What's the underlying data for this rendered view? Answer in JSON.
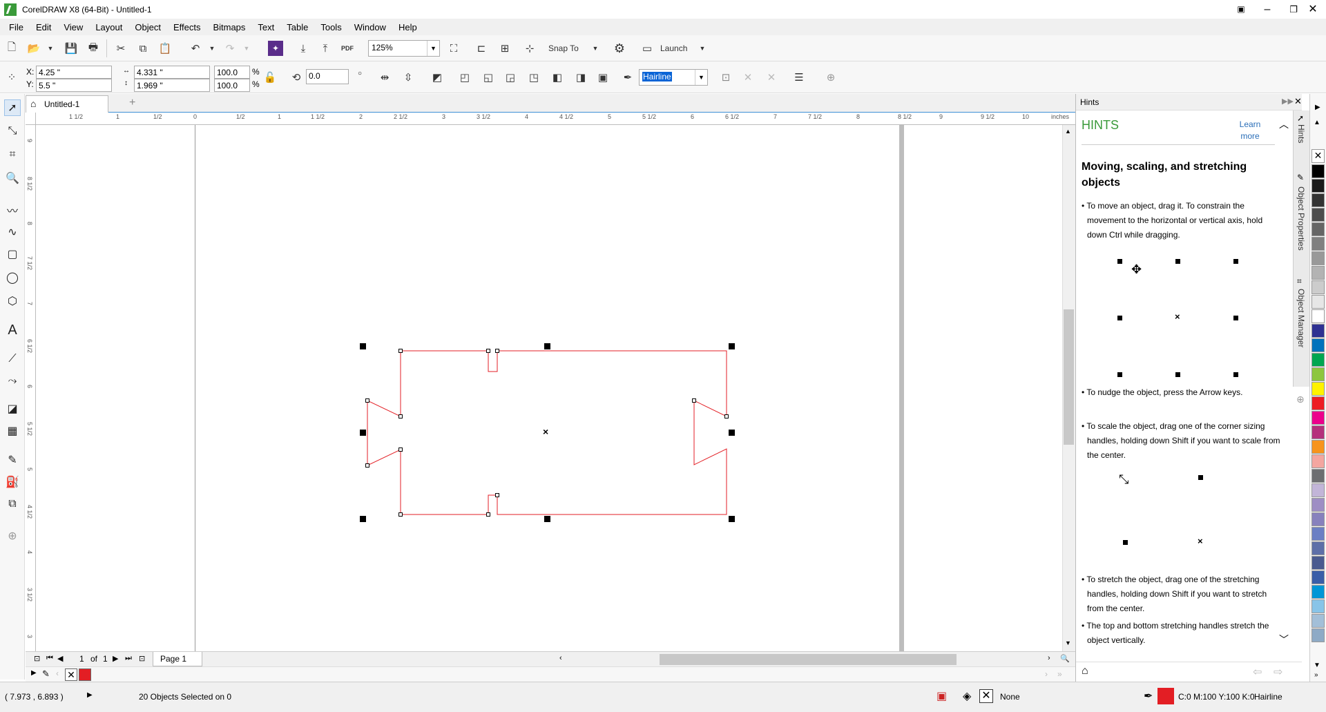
{
  "window": {
    "title": "CorelDRAW X8 (64-Bit) - Untitled-1"
  },
  "menu": [
    "File",
    "Edit",
    "View",
    "Layout",
    "Object",
    "Effects",
    "Bitmaps",
    "Text",
    "Table",
    "Tools",
    "Window",
    "Help"
  ],
  "standard_toolbar": {
    "zoom": "125%",
    "pdf_label": "PDF",
    "snap_to": "Snap To",
    "launch": "Launch"
  },
  "property_bar": {
    "x_label": "X:",
    "x_value": "4.25 \"",
    "y_label": "Y:",
    "y_value": "5.5 \"",
    "width_value": "4.331 \"",
    "height_value": "1.969 \"",
    "scale_w": "100.0",
    "scale_h": "100.0",
    "percent": "%",
    "rotation": "0.0",
    "outline": "Hairline"
  },
  "document": {
    "tab": "Untitled-1",
    "page_counter": {
      "current": "1",
      "of": "of",
      "total": "1"
    },
    "page_tab": "Page 1"
  },
  "rulers": {
    "horizontal": [
      "1 1/2",
      "1",
      "1/2",
      "0",
      "1/2",
      "1",
      "1 1/2",
      "2",
      "2 1/2",
      "3",
      "3 1/2",
      "4",
      "4 1/2",
      "5",
      "5 1/2",
      "6",
      "6 1/2",
      "7",
      "7 1/2",
      "8",
      "8 1/2",
      "9",
      "9 1/2",
      "10"
    ],
    "units": "inches",
    "vertical": [
      "9",
      "8 1/2",
      "8",
      "7 1/2",
      "7",
      "6 1/2",
      "6",
      "5 1/2",
      "5",
      "4 1/2",
      "4",
      "3 1/2",
      "3"
    ]
  },
  "hints": {
    "panel_title": "Hints",
    "header": "HINTS",
    "learn_more": "Learn more",
    "heading": "Moving, scaling, and stretching objects",
    "p1": "• To move an object, drag it. To constrain the movement to the horizontal or vertical axis, hold down Ctrl while dragging.",
    "p2": "• To nudge the object, press the Arrow keys.",
    "p3": "• To scale the object, drag one of the corner sizing handles, holding down Shift if you want to scale from the center.",
    "p4": "• To stretch the object, drag one of the stretching handles, holding down Shift if you want to stretch from the center.",
    "p5": "• The top and bottom stretching handles stretch the object vertically."
  },
  "docker_tabs": [
    "Hints",
    "Object Properties",
    "Object Manager"
  ],
  "status": {
    "coords": "( 7.973 , 6.893 )",
    "selection": "20 Objects Selected on 0",
    "fill_label": "None",
    "outline_color": "C:0 M:100 Y:100 K:0",
    "outline_width": "Hairline"
  },
  "colors": {
    "outline": "#e31e24",
    "palette": [
      "#000000",
      "#1a1a1a",
      "#333333",
      "#4d4d4d",
      "#666666",
      "#808080",
      "#999999",
      "#b3b3b3",
      "#cccccc",
      "#e6e6e6",
      "#ffffff",
      "#2e3192",
      "#0072bc",
      "#00a651",
      "#8dc63f",
      "#fff200",
      "#ed1c24",
      "#ec008c",
      "#b5307c",
      "#f7941d",
      "#f4a6a0",
      "#6d6e71",
      "#c2b5d8",
      "#9e8ec4",
      "#8781bd",
      "#6b7fc4",
      "#5e6fa8",
      "#4a5a8f",
      "#3a5ea8",
      "#0096d6",
      "#88c4e8",
      "#a3bfd8",
      "#8eaac6"
    ]
  }
}
